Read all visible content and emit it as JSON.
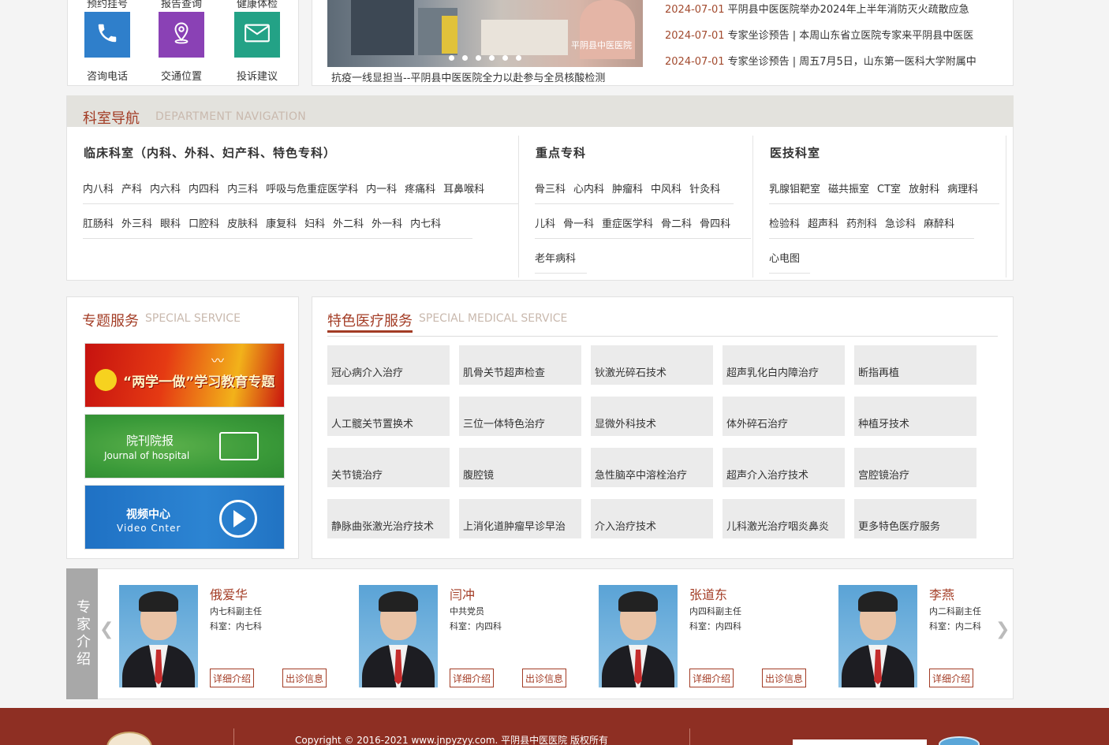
{
  "quick_links": [
    {
      "top_label": "预约挂号",
      "label": "咨询电话",
      "icon": "phone-icon",
      "color": "#2f7fcb"
    },
    {
      "top_label": "报告查询",
      "label": "交通位置",
      "icon": "location-icon",
      "color": "#8a41b5"
    },
    {
      "top_label": "健康体检",
      "label": "投诉建议",
      "icon": "mail-icon",
      "color": "#23a286"
    }
  ],
  "carousel": {
    "caption": "抗疫一线显担当--平阴县中医医院全力以赴参与全员核酸检测",
    "watermark": "平阴县中医医院",
    "dot_count": 6
  },
  "news": [
    {
      "date": "2024-07-01",
      "title": "平阴县中医医院举办2024年上半年消防灭火疏散应急"
    },
    {
      "date": "2024-07-01",
      "title": "专家坐诊预告 | 本周山东省立医院专家来平阴县中医医"
    },
    {
      "date": "2024-07-01",
      "title": "专家坐诊预告 | 周五7月5日，山东第一医科大学附属中"
    }
  ],
  "dept_nav": {
    "title": "科室导航",
    "subtitle": "DEPARTMENT NAVIGATION",
    "clinical": {
      "heading": "临床科室（内科、外科、妇产科、特色专科）",
      "rows": [
        [
          "内八科",
          "产科",
          "内六科",
          "内四科",
          "内三科",
          "呼吸与危重症医学科",
          "内一科",
          "疼痛科",
          "耳鼻喉科"
        ],
        [
          "肛肠科",
          "外三科",
          "眼科",
          "口腔科",
          "皮肤科",
          "康复科",
          "妇科",
          "外二科",
          "外一科",
          "内七科"
        ]
      ]
    },
    "key": {
      "heading": "重点专科",
      "rows": [
        [
          "骨三科",
          "心内科",
          "肿瘤科",
          "中风科",
          "针灸科"
        ],
        [
          "儿科",
          "骨一科",
          "重症医学科",
          "骨二科",
          "骨四科"
        ],
        [
          "老年病科"
        ]
      ]
    },
    "tech": {
      "heading": "医技科室",
      "rows": [
        [
          "乳腺钼靶室",
          "磁共振室",
          "CT室",
          "放射科",
          "病理科"
        ],
        [
          "检验科",
          "超声科",
          "药剂科",
          "急诊科",
          "麻醉科"
        ],
        [
          "心电图"
        ]
      ]
    }
  },
  "special_service": {
    "title": "专题服务",
    "subtitle": "SPECIAL SERVICE",
    "banners": [
      {
        "text": "“两学一做”学习教育专题",
        "en": ""
      },
      {
        "text": "院刊院报",
        "en": "Journal of hospital"
      },
      {
        "text": "视频中心",
        "en": "Video Cnter"
      }
    ]
  },
  "medical_service": {
    "title": "特色医疗服务",
    "subtitle": "SPECIAL MEDICAL SERVICE",
    "items": [
      "冠心病介入治疗",
      "肌骨关节超声检查",
      "钬激光碎石技术",
      "超声乳化白内障治疗",
      "断指再植",
      "人工髋关节置换术",
      "三位一体特色治疗",
      "显微外科技术",
      "体外碎石治疗",
      "种植牙技术",
      "关节镜治疗",
      "腹腔镜",
      "急性脑卒中溶栓治疗",
      "超声介入治疗技术",
      "宫腔镜治疗",
      "静脉曲张激光治疗技术",
      "上消化道肿瘤早诊早治",
      "介入治疗技术",
      "儿科激光治疗咽炎鼻炎",
      "更多特色医疗服务"
    ]
  },
  "experts": {
    "tab_label": "专家介绍",
    "detail_label": "详细介绍",
    "schedule_label": "出诊信息",
    "list": [
      {
        "name": "俄爱华",
        "line1": "内七科副主任",
        "line2": "科室：内七科"
      },
      {
        "name": "闫冲",
        "line1": "中共党员",
        "line2": "科室：内四科"
      },
      {
        "name": "张道东",
        "line1": "内四科副主任",
        "line2": "科室：内四科"
      },
      {
        "name": "李燕",
        "line1": "内二科副主任",
        "line2": "科室：内二科"
      }
    ]
  },
  "footer": {
    "copyright": "Copyright © 2016-2021 www.jnpyzyy.com. 平阴县中医医院 版权所有"
  }
}
